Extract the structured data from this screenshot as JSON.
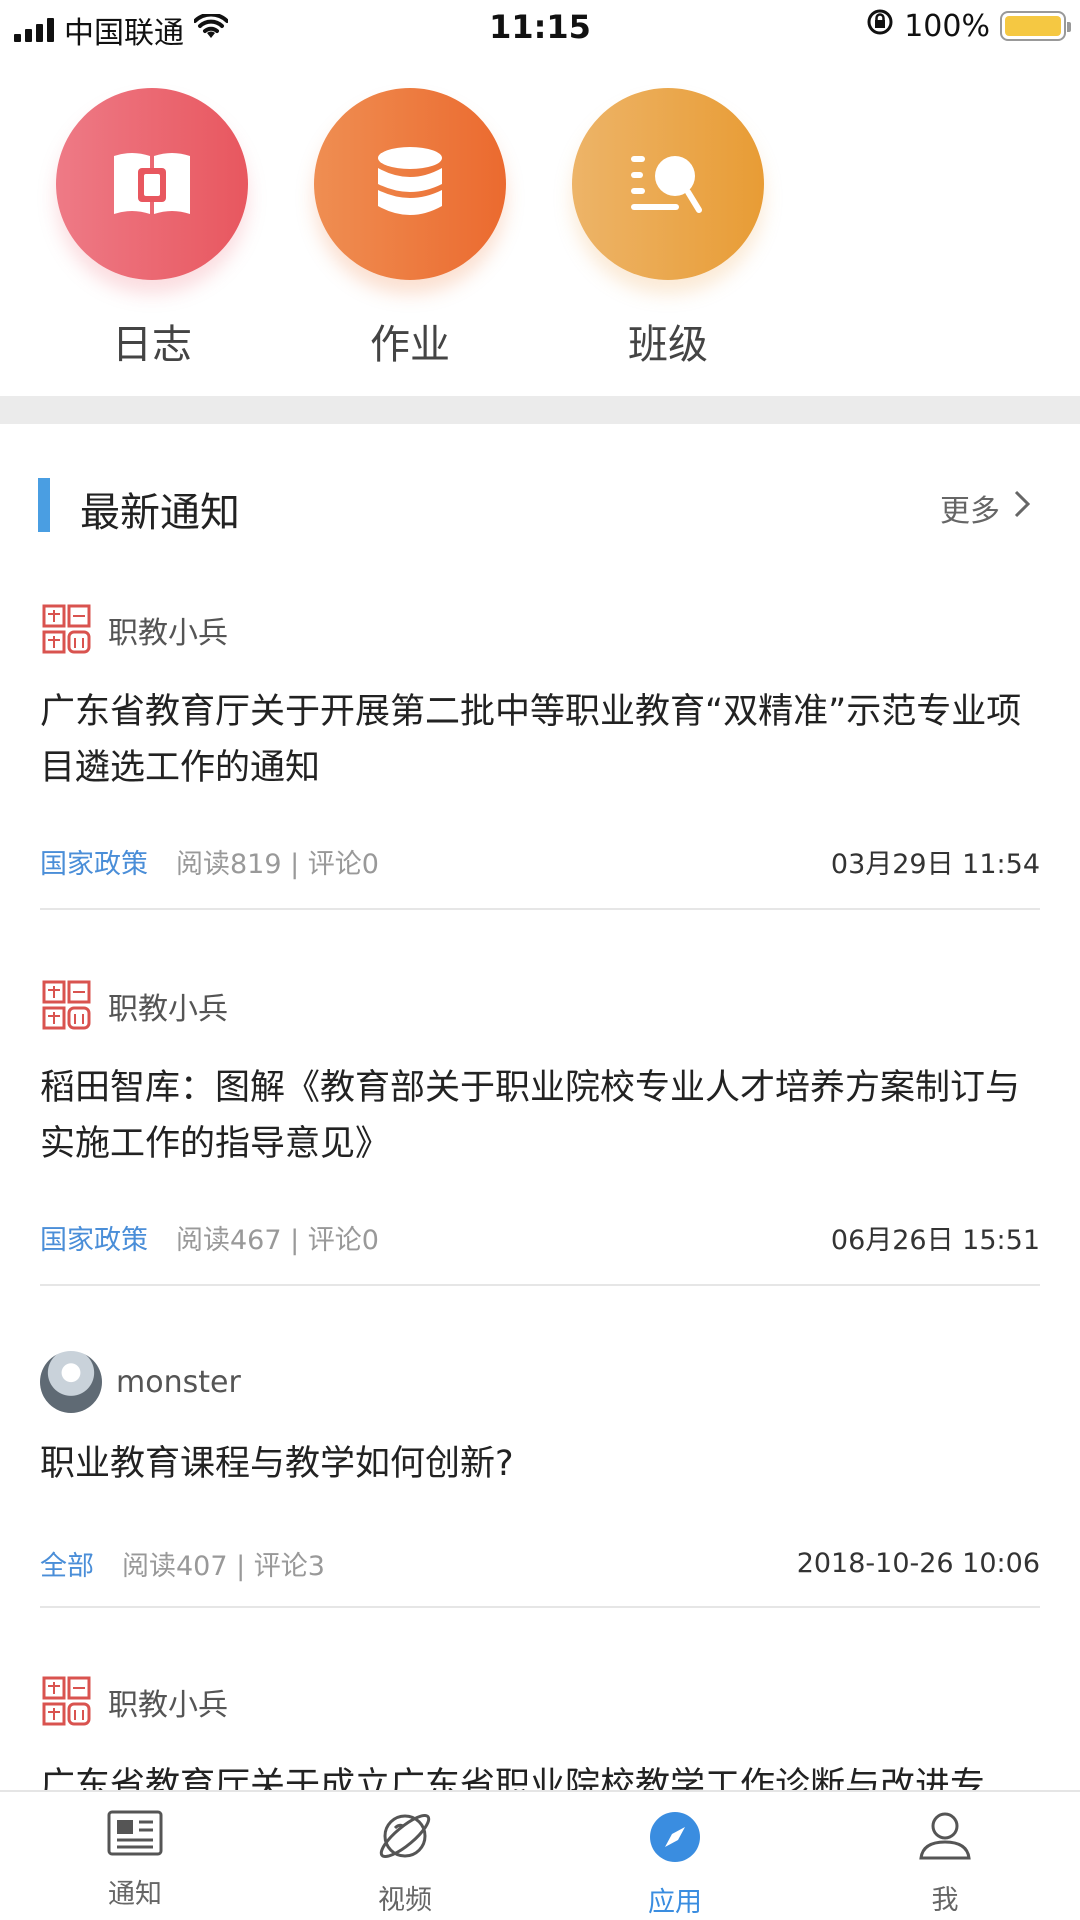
{
  "status_bar": {
    "carrier": "中国联通",
    "time": "11:15",
    "battery": "100%"
  },
  "apps": [
    {
      "label": "日志",
      "icon": "book-icon"
    },
    {
      "label": "作业",
      "icon": "database-icon"
    },
    {
      "label": "班级",
      "icon": "search-list-icon"
    }
  ],
  "section": {
    "title": "最新通知",
    "more": "更多"
  },
  "news": [
    {
      "author": "职教小兵",
      "title": "广东省教育厅关于开展第二批中等职业教育“双精准”示范专业项目遴选工作的通知",
      "tag": "国家政策",
      "stats": "阅读819 | 评论0",
      "date": "03月29日 11:54"
    },
    {
      "author": "职教小兵",
      "title": "稻田智库：图解《教育部关于职业院校专业人才培养方案制订与实施工作的指导意见》",
      "tag": "国家政策",
      "stats": "阅读467 | 评论0",
      "date": "06月26日 15:51"
    },
    {
      "author": "monster",
      "title": "职业教育课程与教学如何创新?",
      "tag": "全部",
      "stats": "阅读407 | 评论3",
      "date": "2018-10-26 10:06"
    },
    {
      "author": "职教小兵",
      "title": "广东省教育厅关于成立广东省职业院校教学工作诊断与改进专"
    }
  ],
  "tabs": [
    {
      "label": "通知",
      "icon": "newspaper-icon"
    },
    {
      "label": "视频",
      "icon": "planet-icon"
    },
    {
      "label": "应用",
      "icon": "compass-icon"
    },
    {
      "label": "我",
      "icon": "user-icon"
    }
  ],
  "colors": {
    "accent": "#3a8de0",
    "tag": "#4a8ed8",
    "log": "#e8575f",
    "homework": "#eb6a2f",
    "class": "#e89c35"
  }
}
